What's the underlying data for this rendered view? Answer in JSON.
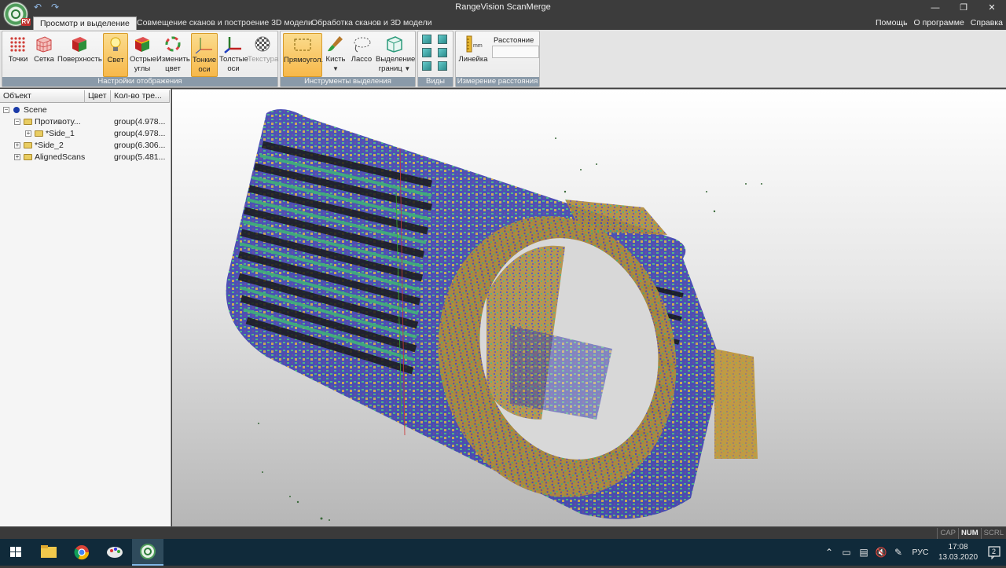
{
  "window": {
    "title": "RangeVision ScanMerge",
    "minimize_icon": "minimize-icon",
    "maximize_icon": "restore-icon",
    "close_icon": "close-icon",
    "logo_badge": "RV"
  },
  "tabs": [
    {
      "label": "Просмотр и выделение",
      "active": true
    },
    {
      "label": "Совмещение сканов и построение 3D модели",
      "active": false
    },
    {
      "label": "Обработка сканов и 3D модели",
      "active": false
    }
  ],
  "help_links": {
    "help": "Помощь",
    "about": "О программе",
    "reference": "Справка"
  },
  "ribbon": {
    "display_settings": {
      "label": "Настройки отображения",
      "buttons": [
        {
          "line1": "Точки",
          "line2": "",
          "icon": "points-icon",
          "active": false,
          "disabled": false
        },
        {
          "line1": "Сетка",
          "line2": "",
          "icon": "mesh-icon",
          "active": false,
          "disabled": false
        },
        {
          "line1": "Поверхность",
          "line2": "",
          "icon": "surface-icon",
          "active": false,
          "disabled": false
        },
        {
          "line1": "Свет",
          "line2": "",
          "icon": "light-bulb-icon",
          "active": true,
          "disabled": false
        },
        {
          "line1": "Острые",
          "line2": "углы",
          "icon": "sharp-corners-icon",
          "active": false,
          "disabled": false
        },
        {
          "line1": "Изменить",
          "line2": "цвет",
          "icon": "color-change-icon",
          "active": false,
          "disabled": false
        },
        {
          "line1": "Тонкие",
          "line2": "оси",
          "icon": "thin-axes-icon",
          "active": true,
          "disabled": false
        },
        {
          "line1": "Толстые",
          "line2": "оси",
          "icon": "thick-axes-icon",
          "active": false,
          "disabled": false
        },
        {
          "line1": "Текстура",
          "line2": "",
          "icon": "texture-icon",
          "active": false,
          "disabled": true
        }
      ]
    },
    "selection_tools": {
      "label": "Инструменты выделения",
      "buttons": [
        {
          "line1": "Прямоугол.",
          "line2": "",
          "icon": "rectangle-select-icon",
          "active": true,
          "dropdown": false
        },
        {
          "line1": "Кисть",
          "line2": "",
          "icon": "brush-icon",
          "active": false,
          "dropdown": true
        },
        {
          "line1": "Лассо",
          "line2": "",
          "icon": "lasso-icon",
          "active": false,
          "dropdown": false
        },
        {
          "line1": "Выделение",
          "line2": "границ",
          "icon": "border-select-icon",
          "active": false,
          "dropdown": true
        }
      ]
    },
    "views": {
      "label": "Виды",
      "icon": "view-cube-icon"
    },
    "distance": {
      "label": "Измерение расстояния",
      "ruler_label": "Линейка",
      "ruler_icon": "ruler-icon",
      "distance_caption": "Расстояние",
      "distance_value": ""
    }
  },
  "tree": {
    "headers": {
      "object": "Объект",
      "color": "Цвет",
      "count": "Кол-во тре..."
    },
    "rows": [
      {
        "name": "Scene",
        "count": "",
        "level": 0,
        "expander": "−",
        "icon": "scene-dot-icon"
      },
      {
        "name": "Противоту...",
        "count": "group(4.978...",
        "level": 1,
        "expander": "−",
        "icon": "folder-icon"
      },
      {
        "name": "*Side_1",
        "count": "group(4.978...",
        "level": 2,
        "expander": "+",
        "icon": "folder-icon"
      },
      {
        "name": "*Side_2",
        "count": "group(6.306...",
        "level": 1,
        "expander": "+",
        "icon": "folder-icon"
      },
      {
        "name": "AlignedScans",
        "count": "group(5.481...",
        "level": 1,
        "expander": "+",
        "icon": "folder-icon"
      }
    ]
  },
  "status_keys": [
    {
      "label": "CAP",
      "on": false
    },
    {
      "label": "NUM",
      "on": true
    },
    {
      "label": "SCRL",
      "on": false
    }
  ],
  "taskbar": {
    "apps": [
      "windows-start-icon",
      "file-explorer-icon",
      "chrome-icon",
      "paint-icon",
      "scanmerge-icon"
    ],
    "tray_icons": [
      "chevron-up-icon",
      "battery-icon",
      "network-icon",
      "volume-mute-icon",
      "pen-icon"
    ],
    "language": "РУС",
    "time": "17:08",
    "date": "13.03.2020",
    "notification_count": "2"
  },
  "colors": {
    "mesh_blue": "#3a3fb0",
    "mesh_green": "#3fb07a",
    "mesh_tan": "#c8a24a",
    "mesh_purple": "#5a3f9a",
    "active_button": "#f7b84a",
    "group_label_bg": "#8a9aa9"
  }
}
